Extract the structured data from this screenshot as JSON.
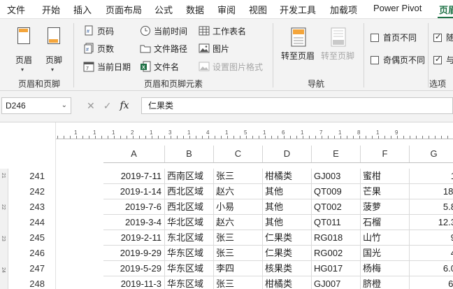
{
  "menu": [
    "文件",
    "开始",
    "插入",
    "页面布局",
    "公式",
    "数据",
    "审阅",
    "视图",
    "开发工具",
    "加载项",
    "Power Pivot",
    "页眉"
  ],
  "ribbon": {
    "header_btn": "页眉",
    "footer_btn": "页脚",
    "group1_label": "页眉和页脚",
    "elements": [
      "页码",
      "页数",
      "当前日期",
      "当前时间",
      "文件路径",
      "文件名",
      "工作表名",
      "图片",
      "设置图片格式"
    ],
    "group2_label": "页眉和页脚元素",
    "goto_header": "转至页眉",
    "goto_footer": "转至页脚",
    "group3_label": "导航",
    "options": [
      {
        "label": "首页不同",
        "checked": false
      },
      {
        "label": "奇偶页不同",
        "checked": false
      },
      {
        "label": "随",
        "checked": true
      },
      {
        "label": "与",
        "checked": true
      }
    ],
    "group4_label": "选项"
  },
  "formula_bar": {
    "name_box": "D246",
    "fx": "fx",
    "content": "仁果类"
  },
  "ruler_numbers": [
    "1",
    "1",
    "1",
    "2",
    "1",
    "3",
    "1",
    "4",
    "1",
    "5",
    "1",
    "6",
    "1",
    "7",
    "1",
    "8",
    "1",
    "9"
  ],
  "vruler_labels": [
    "21",
    "22",
    "23",
    "24"
  ],
  "columns": [
    "A",
    "B",
    "C",
    "D",
    "E",
    "F",
    "G"
  ],
  "rows": [
    {
      "num": "241",
      "cells": [
        "2019-7-11",
        "西南区域",
        "张三",
        "柑橘类",
        "GJ003",
        "蜜柑",
        "1"
      ]
    },
    {
      "num": "242",
      "cells": [
        "2019-1-14",
        "西北区域",
        "赵六",
        "其他",
        "QT009",
        "芒果",
        "18."
      ]
    },
    {
      "num": "243",
      "cells": [
        "2019-7-6",
        "西北区域",
        "小易",
        "其他",
        "QT002",
        "菠萝",
        "5.8"
      ]
    },
    {
      "num": "244",
      "cells": [
        "2019-3-4",
        "华北区域",
        "赵六",
        "其他",
        "QT011",
        "石榴",
        "12.3"
      ]
    },
    {
      "num": "245",
      "cells": [
        "2019-2-11",
        "东北区域",
        "张三",
        "仁果类",
        "RG018",
        "山竹",
        "9"
      ]
    },
    {
      "num": "246",
      "cells": [
        "2019-9-29",
        "华东区域",
        "张三",
        "仁果类",
        "RG002",
        "国光",
        "4"
      ]
    },
    {
      "num": "247",
      "cells": [
        "2019-5-29",
        "华东区域",
        "李四",
        "核果类",
        "HG017",
        "杨梅",
        "6.0"
      ]
    },
    {
      "num": "248",
      "cells": [
        "2019-11-3",
        "华东区域",
        "张三",
        "柑橘类",
        "GJ007",
        "脐橙",
        "6."
      ]
    }
  ],
  "accent_color": "#1e7145"
}
